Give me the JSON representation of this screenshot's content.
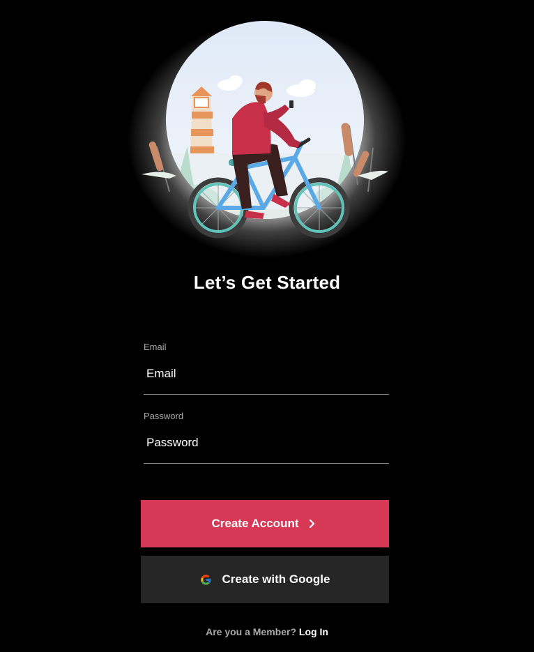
{
  "hero": {
    "illustration_icon": "cyclist-illustration"
  },
  "heading": {
    "title": "Let’s Get Started"
  },
  "form": {
    "email": {
      "label": "Email",
      "placeholder": "Email",
      "value": ""
    },
    "password": {
      "label": "Password",
      "placeholder": "Password",
      "value": ""
    }
  },
  "actions": {
    "create_account_label": "Create Account",
    "create_account_icon": "chevron-right-icon",
    "google_label": "Create with Google",
    "google_icon": "google-icon"
  },
  "footer": {
    "prompt": "Are you a Member?",
    "login_label": "Log In"
  },
  "colors": {
    "background": "#000000",
    "primary": "#d63855",
    "secondary_button": "#262626",
    "muted_text": "#a8a8a8",
    "divider": "#8f8f8f"
  }
}
